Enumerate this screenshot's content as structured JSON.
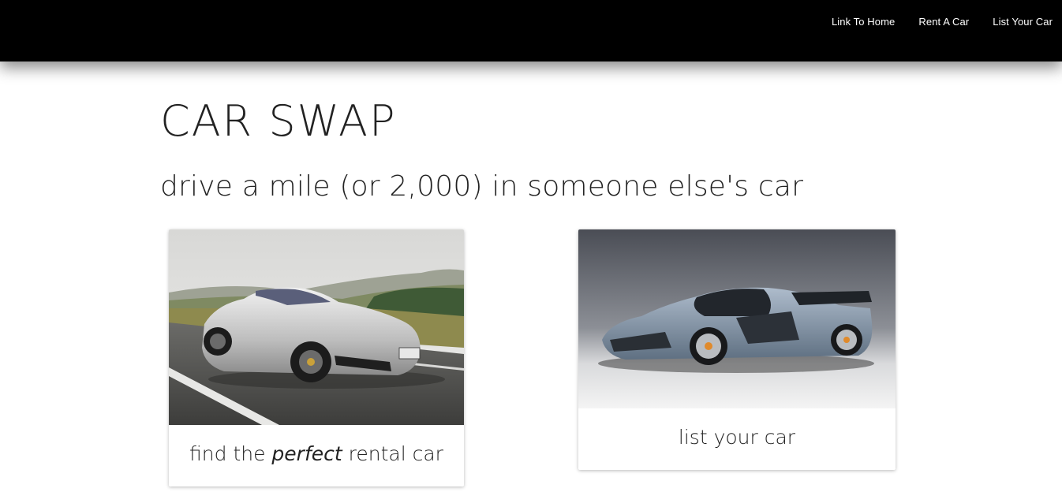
{
  "nav": {
    "links": [
      {
        "label": "Link To Home"
      },
      {
        "label": "Rent A Car"
      },
      {
        "label": "List Your Car"
      }
    ]
  },
  "hero": {
    "title": "CAR SWAP",
    "tagline": "drive a mile (or 2,000) in someone else's car"
  },
  "cards": {
    "rent": {
      "caption_before": "find the ",
      "caption_emphasis": "perfect",
      "caption_after": " rental car",
      "image": "silver-sports-coupe-photo"
    },
    "list": {
      "caption": "list your car",
      "image": "blue-grey-supercar-photo"
    }
  },
  "colors": {
    "nav_bg": "#000000",
    "nav_text": "#ffffff",
    "text": "#222222",
    "page_bg": "#ffffff"
  }
}
